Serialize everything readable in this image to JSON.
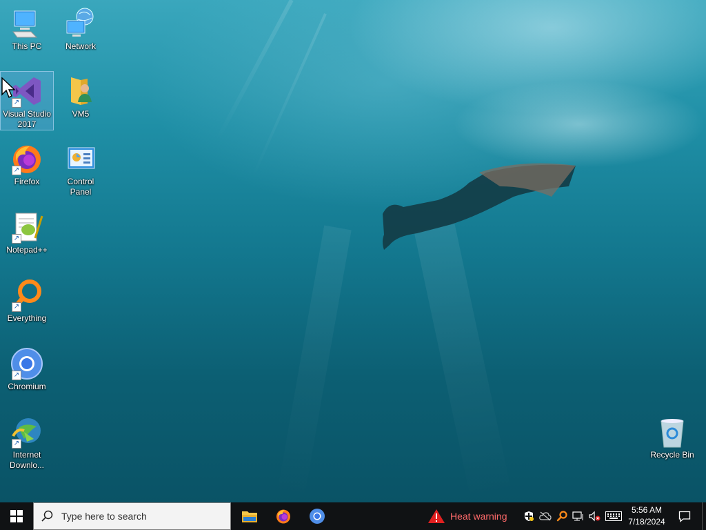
{
  "desktop": {
    "icons": [
      {
        "label": "This PC",
        "icon": "computer-icon"
      },
      {
        "label": "Network",
        "icon": "network-icon"
      },
      {
        "label": "Visual Studio 2017",
        "icon": "visual-studio-icon"
      },
      {
        "label": "VM5",
        "icon": "user-folder-icon"
      },
      {
        "label": "Firefox",
        "icon": "firefox-icon"
      },
      {
        "label": "Control Panel",
        "icon": "control-panel-icon"
      },
      {
        "label": "Notepad++",
        "icon": "notepadpp-icon"
      },
      {
        "label": "Everything",
        "icon": "everything-search-icon"
      },
      {
        "label": "Chromium",
        "icon": "chromium-icon"
      },
      {
        "label": "Internet Downlo...",
        "icon": "internet-download-manager-icon"
      },
      {
        "label": "Recycle Bin",
        "icon": "recycle-bin-icon"
      }
    ],
    "selected_icon": "Visual Studio 2017"
  },
  "taskbar": {
    "search_placeholder": "Type here to search",
    "pinned_apps": [
      "file-explorer-icon",
      "firefox-icon",
      "chromium-icon"
    ],
    "weather_alert": "Heat warning",
    "tray_icons": [
      "windows-security-icon",
      "cloud-sync-icon",
      "everything-tray-icon",
      "network-icon",
      "volume-muted-icon",
      "keyboard-icon"
    ],
    "clock": {
      "time": "5:56 AM",
      "date": "7/18/2024"
    },
    "colors": {
      "taskbar": "#101214",
      "alert": "#ff6a6a"
    }
  }
}
